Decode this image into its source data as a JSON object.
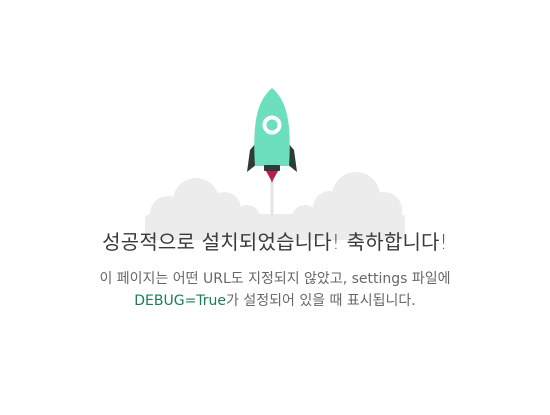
{
  "heading": "성공적으로 설치되었습니다! 축하합니다!",
  "message": {
    "part1": "이 페이지는 어떤 URL도 지정되지 않았고, settings 파일에 ",
    "highlight": "DEBUG=True",
    "part2": "가 설정되어 있을 때 표시됩니다."
  },
  "colors": {
    "rocket_body": "#6ddfbe",
    "rocket_fins": "#2b3b36",
    "flame": "#b91e4a",
    "cloud": "#ececec",
    "accent_text": "#1c7c5a"
  },
  "icons": {
    "illustration": "rocket-launch-icon"
  }
}
